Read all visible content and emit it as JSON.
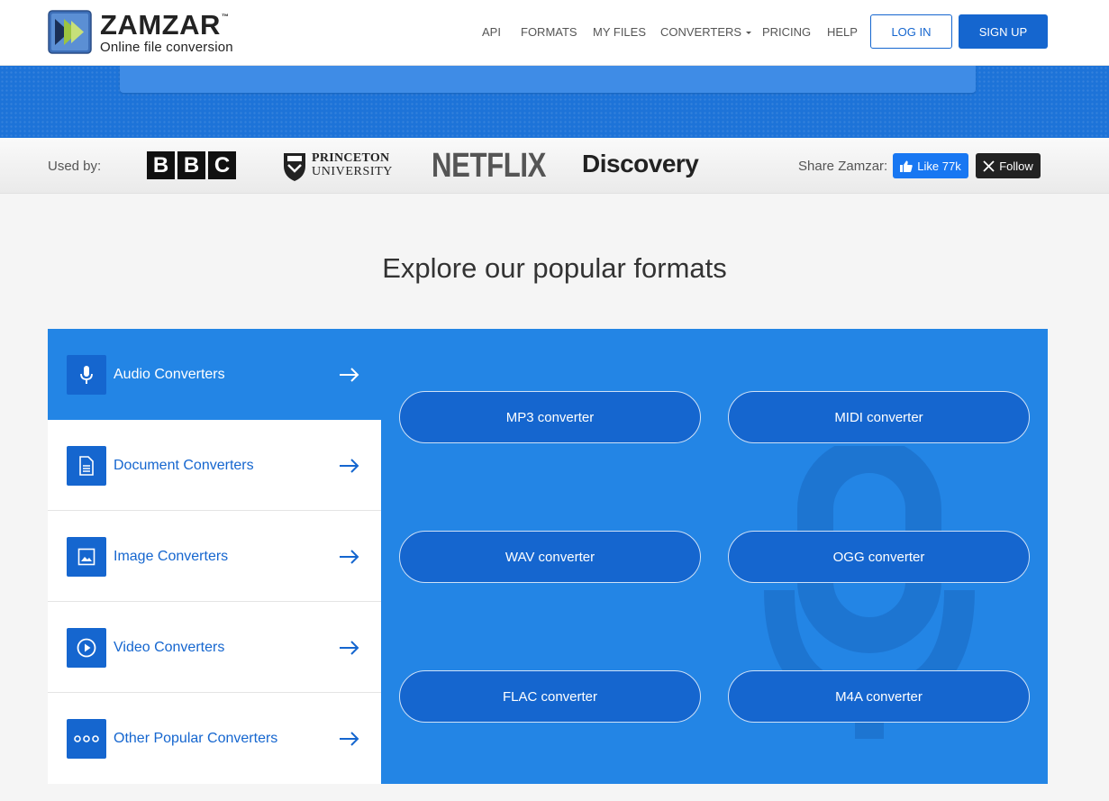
{
  "header": {
    "logo_name": "ZAMZAR",
    "logo_tm": "™",
    "logo_tagline": "Online file conversion",
    "nav": [
      "API",
      "FORMATS",
      "MY FILES",
      "CONVERTERS",
      "PRICING",
      "HELP"
    ],
    "login_label": "LOG IN",
    "signup_label": "SIGN UP"
  },
  "usedby": {
    "label": "Used by:",
    "bbc_letters": [
      "B",
      "B",
      "C"
    ],
    "princeton_line1": "PRINCETON",
    "princeton_line2": "UNIVERSITY",
    "netflix": "NETFLIX",
    "discovery": "Discovery",
    "share_label": "Share Zamzar:",
    "like_label": "Like 77k",
    "follow_label": "Follow"
  },
  "section": {
    "title": "Explore our popular formats"
  },
  "categories": [
    {
      "label": "Audio Converters",
      "icon": "microphone-icon",
      "active": true
    },
    {
      "label": "Document Converters",
      "icon": "document-icon",
      "active": false
    },
    {
      "label": "Image Converters",
      "icon": "image-icon",
      "active": false
    },
    {
      "label": "Video Converters",
      "icon": "play-icon",
      "active": false
    },
    {
      "label": "Other Popular Converters",
      "icon": "more-dots-icon",
      "active": false
    }
  ],
  "converters": [
    "MP3 converter",
    "MIDI converter",
    "WAV converter",
    "OGG converter",
    "FLAC converter",
    "M4A converter"
  ],
  "colors": {
    "brand_blue": "#1566cf",
    "panel_blue": "#2385e5",
    "facebook_blue": "#1877f2"
  }
}
